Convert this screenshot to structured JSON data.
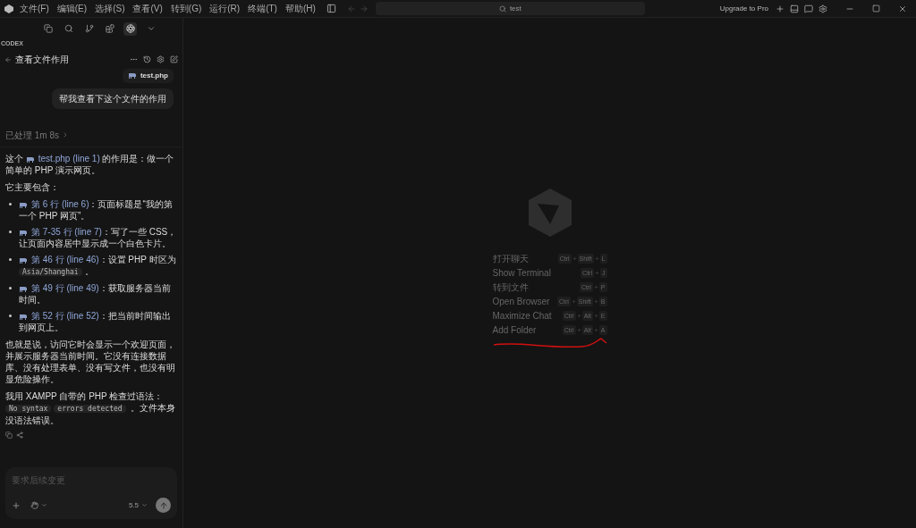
{
  "menu": [
    "文件(F)",
    "编辑(E)",
    "选择(S)",
    "查看(V)",
    "转到(G)",
    "运行(R)",
    "终端(T)",
    "帮助(H)"
  ],
  "search": {
    "value": "test"
  },
  "upgrade": "Upgrade to Pro",
  "sidebar": {
    "tools": [
      {
        "kind": "files",
        "selected": false
      },
      {
        "kind": "search",
        "selected": false
      },
      {
        "kind": "branch",
        "selected": false
      },
      {
        "kind": "extensions",
        "selected": false
      },
      {
        "kind": "codex",
        "selected": true
      },
      {
        "kind": "more",
        "selected": false
      }
    ],
    "section": "CODEX",
    "thread_title": "查看文件作用",
    "attachment": "test.php",
    "user_message": "帮我查看下这个文件的作用",
    "status": "已处理 1m 8s",
    "answer": [
      {
        "kind": "paragraph",
        "parts": [
          {
            "kind": "text",
            "text": "这个 "
          },
          {
            "kind": "ref",
            "text": "test.php (line 1)"
          },
          {
            "kind": "text",
            "text": " 的作用是：做一个简单的 PHP 演示网页。"
          }
        ]
      },
      {
        "kind": "paragraph",
        "parts": [
          {
            "kind": "text",
            "text": "它主要包含："
          }
        ]
      },
      {
        "kind": "bullets",
        "items": [
          {
            "parts": [
              {
                "kind": "ref",
                "text": "第 6 行 (line 6)"
              },
              {
                "kind": "text",
                "text": "：页面标题是“我的第一个 PHP 网页”。"
              }
            ]
          },
          {
            "parts": [
              {
                "kind": "ref",
                "text": "第 7-35 行 (line 7)"
              },
              {
                "kind": "text",
                "text": "：写了一些 CSS，让页面内容居中显示成一个白色卡片。"
              }
            ]
          },
          {
            "parts": [
              {
                "kind": "ref",
                "text": "第 46 行 (line 46)"
              },
              {
                "kind": "text",
                "text": "：设置 PHP 时区为 "
              },
              {
                "kind": "code",
                "text": "Asia/Shanghai"
              },
              {
                "kind": "text",
                "text": "。"
              }
            ]
          },
          {
            "parts": [
              {
                "kind": "ref",
                "text": "第 49 行 (line 49)"
              },
              {
                "kind": "text",
                "text": "：获取服务器当前时间。"
              }
            ]
          },
          {
            "parts": [
              {
                "kind": "ref",
                "text": "第 52 行 (line 52)"
              },
              {
                "kind": "text",
                "text": "：把当前时间输出到网页上。"
              }
            ]
          }
        ]
      },
      {
        "kind": "paragraph",
        "parts": [
          {
            "kind": "text",
            "text": "也就是说，访问它时会显示一个欢迎页面，并展示服务器当前时间。它没有连接数据库、没有处理表单、没有写文件，也没有明显危险操作。"
          }
        ]
      },
      {
        "kind": "paragraph",
        "parts": [
          {
            "kind": "text",
            "text": "我用 XAMPP 自带的 PHP 检查过语法： "
          },
          {
            "kind": "code",
            "text": "No syntax"
          },
          {
            "kind": "code",
            "text": "errors detected"
          },
          {
            "kind": "text",
            "text": " 。文件本身没语法错误。"
          }
        ]
      }
    ],
    "composer": {
      "placeholder": "要求后续变更",
      "model": "5.5"
    }
  },
  "shortcuts": [
    {
      "label": "打开聊天",
      "keys": [
        "Ctrl",
        "Shift",
        "L"
      ]
    },
    {
      "label": "Show Terminal",
      "keys": [
        "Ctrl",
        "J"
      ]
    },
    {
      "label": "转到文件",
      "keys": [
        "Ctrl",
        "P"
      ]
    },
    {
      "label": "Open Browser",
      "keys": [
        "Ctrl",
        "Shift",
        "B"
      ]
    },
    {
      "label": "Maximize Chat",
      "keys": [
        "Ctrl",
        "Alt",
        "E"
      ]
    },
    {
      "label": "Add Folder",
      "keys": [
        "Ctrl",
        "Alt",
        "A"
      ]
    }
  ]
}
